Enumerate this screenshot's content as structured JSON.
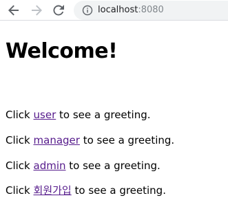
{
  "browser": {
    "url_host": "localhost",
    "url_port": ":8080",
    "icons": {
      "back": "back-arrow-icon",
      "forward": "forward-arrow-icon",
      "reload": "reload-icon",
      "info": "info-icon"
    }
  },
  "page": {
    "title": "Welcome!",
    "lines": [
      {
        "prefix": "Click ",
        "link": "user",
        "suffix": " to see a greeting."
      },
      {
        "prefix": "Click ",
        "link": "manager",
        "suffix": " to see a greeting."
      },
      {
        "prefix": "Click ",
        "link": "admin",
        "suffix": " to see a greeting."
      },
      {
        "prefix": "Click ",
        "link": "회원가입",
        "suffix": " to see a greeting."
      }
    ]
  },
  "colors": {
    "visited_link": "#551a8b",
    "text": "#000000",
    "omnibox_bg": "#f1f3f4"
  }
}
